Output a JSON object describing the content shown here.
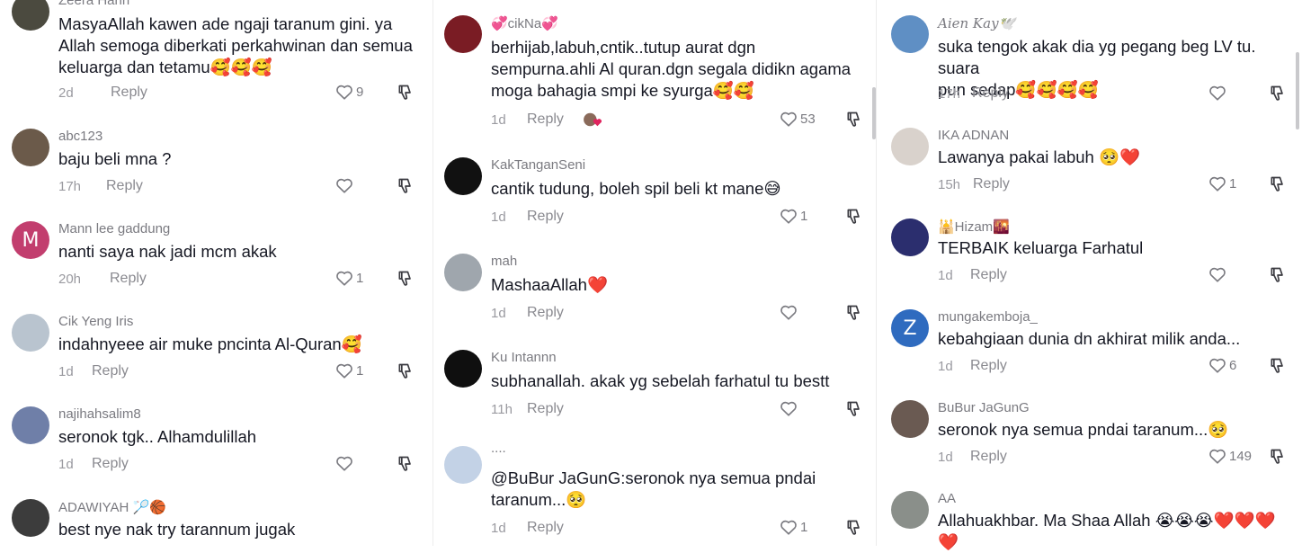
{
  "columns": [
    {
      "comments": [
        {
          "user": "Zeera Hariri",
          "text": "MasyaAllah kawen ade ngaji taranum gini. ya\nAllah semoga diberkati perkahwinan dan semua\nkeluarga dan tetamu🥰🥰🥰",
          "time": "2d",
          "reply": "Reply",
          "likes": "9",
          "avatar_color": "#4b4a3f"
        },
        {
          "user": "abc123",
          "text": "baju beli mna ?",
          "time": "17h",
          "reply": "Reply",
          "likes": "",
          "avatar_color": "#6b5a4a"
        },
        {
          "user": "Mann lee gaddung",
          "text": "nanti saya nak jadi mcm akak",
          "time": "20h",
          "reply": "Reply",
          "likes": "1",
          "avatar_color": "#c23e6e",
          "avatar_letter": "M"
        },
        {
          "user": "Cik Yeng Iris",
          "text": "indahnyeee air muke pncinta Al-Quran🥰",
          "time": "1d",
          "reply": "Reply",
          "likes": "1",
          "avatar_color": "#b9c4cf"
        },
        {
          "user": "najihahsalim8",
          "text": "seronok tgk.. Alhamdulillah",
          "time": "1d",
          "reply": "Reply",
          "likes": "",
          "avatar_color": "#6f7fa8"
        },
        {
          "user": "ADAWIYAH 🏸🏀",
          "text": "best nye nak try tarannum jugak",
          "time": "",
          "reply": "",
          "likes": "",
          "avatar_color": "#3c3c3c"
        }
      ]
    },
    {
      "comments": [
        {
          "user": "💞cikNa💞",
          "text": "berhijab,labuh,cntik..tutup aurat dgn\nsempurna.ahli Al quran.dgn segala didikn agama\nmoga bahagia smpi ke syurga🥰🥰",
          "time": "1d",
          "reply": "Reply",
          "likes": "53",
          "avatar_color": "#7a1c24"
        },
        {
          "user": "KakTanganSeni",
          "text": "cantik tudung, boleh spil beli kt mane😅",
          "time": "1d",
          "reply": "Reply",
          "likes": "1",
          "avatar_color": "#111111"
        },
        {
          "user": "mah",
          "text": "MashaaAllah❤️",
          "time": "1d",
          "reply": "Reply",
          "likes": "",
          "avatar_color": "#9fa6ad"
        },
        {
          "user": "Ku Intannn",
          "text": "subhanallah. akak yg sebelah farhatul tu bestt",
          "time": "11h",
          "reply": "Reply",
          "likes": "",
          "avatar_color": "#0f0f0f"
        },
        {
          "user": "....",
          "text": "@BuBur JaGunG:seronok nya semua pndai\ntaranum...🥺",
          "time": "1d",
          "reply": "Reply",
          "likes": "1",
          "avatar_color": "#c3d2e6"
        }
      ]
    },
    {
      "comments": [
        {
          "user": "Aien Kay🕊️",
          "text": "suka tengok akak dia yg pegang beg LV tu. suara\npun sedap🥰🥰🥰🥰",
          "time": "17h",
          "reply": "Reply",
          "likes": "",
          "avatar_color": "#5f8fc4"
        },
        {
          "user": "IKA ADNAN",
          "text": "Lawanya pakai labuh 🥺❤️",
          "time": "15h",
          "reply": "Reply",
          "likes": "1",
          "avatar_color": "#d9d2cc"
        },
        {
          "user": "🕌Hizam🌇",
          "text": "TERBAIK keluarga Farhatul",
          "time": "1d",
          "reply": "Reply",
          "likes": "",
          "avatar_color": "#2b2e6e"
        },
        {
          "user": "mungakemboja_",
          "text": "kebahgiaan dunia dn akhirat milik anda...",
          "time": "1d",
          "reply": "Reply",
          "likes": "6",
          "avatar_color": "#2f6bbf",
          "avatar_letter": "Z"
        },
        {
          "user": "BuBur JaGunG",
          "text": "seronok nya semua pndai taranum...🥺",
          "time": "1d",
          "reply": "Reply",
          "likes": "149",
          "avatar_color": "#6a5a52"
        },
        {
          "user": "AA",
          "text": "Allahuakhbar. Ma Shaa Allah 😭😭😭❤️❤️❤️\n❤️",
          "time": "",
          "reply": "",
          "likes": "",
          "avatar_color": "#8a8f8a"
        }
      ]
    }
  ]
}
